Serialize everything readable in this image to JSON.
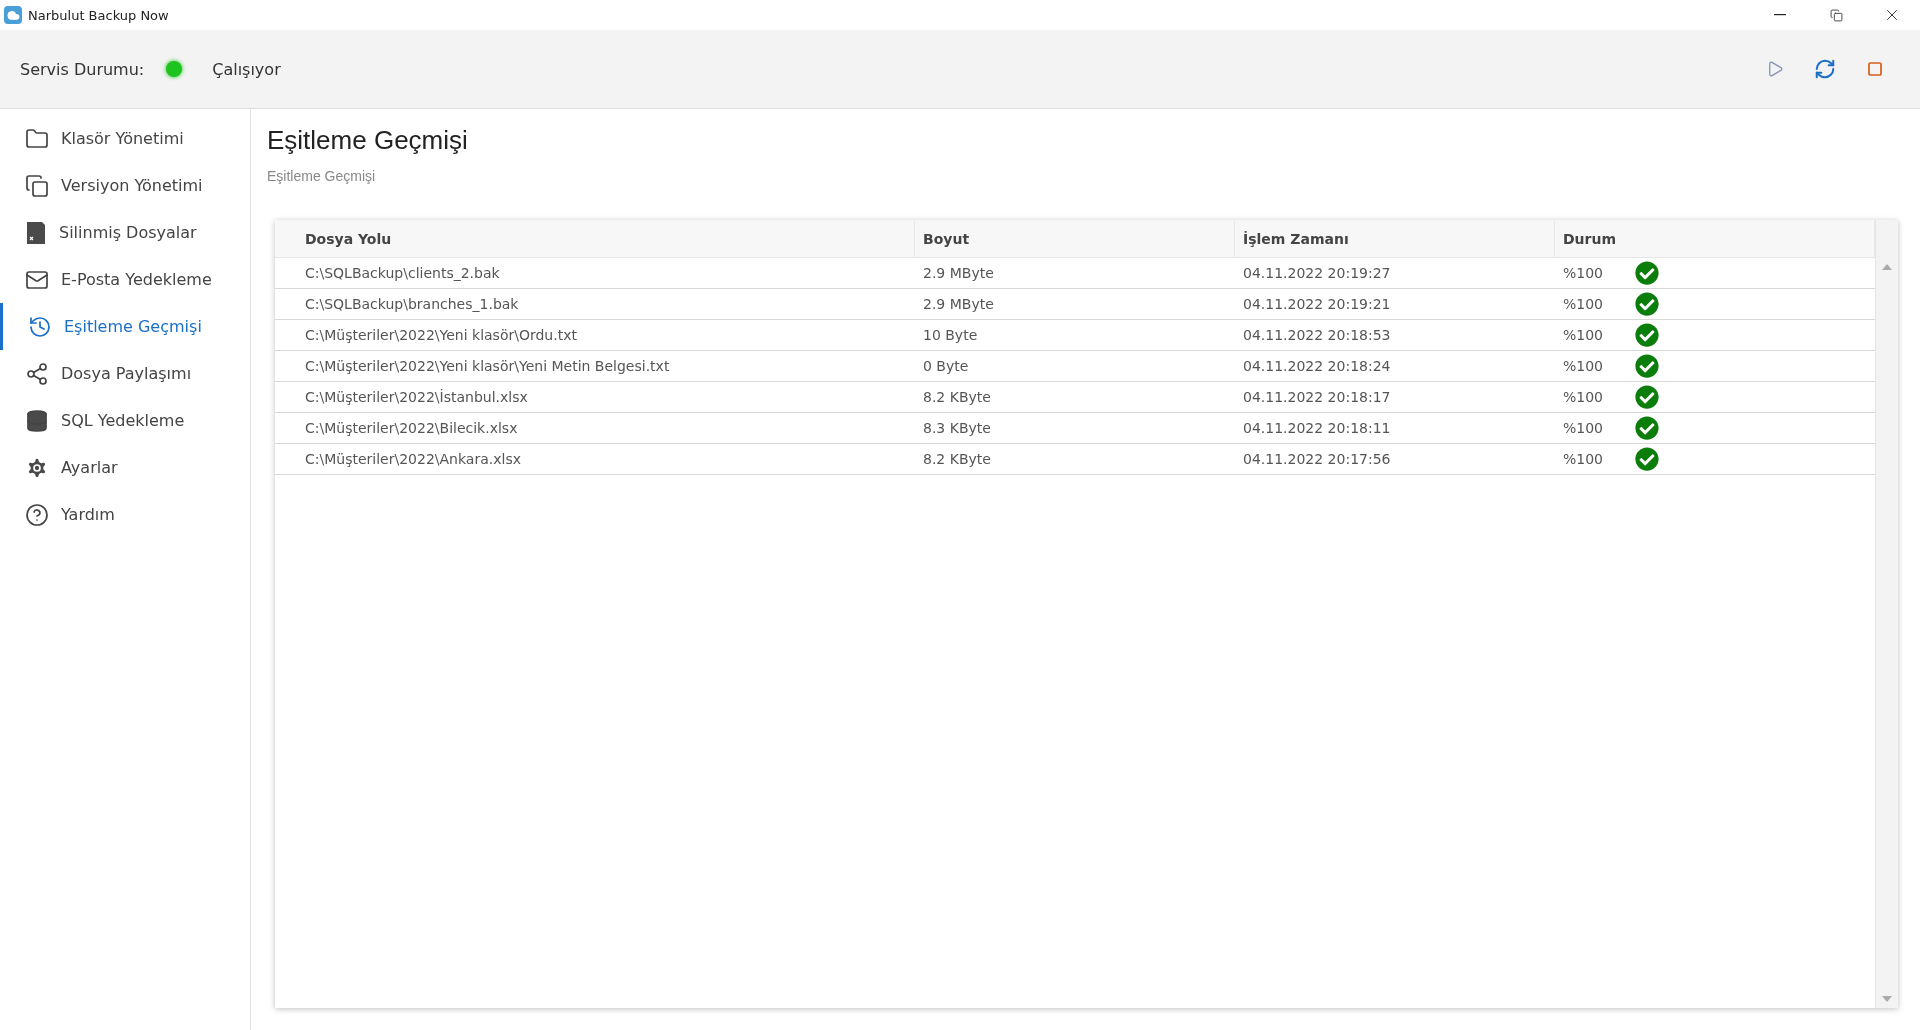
{
  "window": {
    "title": "Narbulut Backup Now"
  },
  "service": {
    "label": "Servis Durumu:",
    "running": true,
    "status_text": "Çalışıyor"
  },
  "sidebar": {
    "items": [
      {
        "label": "Klasör Yönetimi",
        "selected": false
      },
      {
        "label": "Versiyon Yönetimi",
        "selected": false
      },
      {
        "label": "Silinmiş Dosyalar",
        "selected": false
      },
      {
        "label": "E-Posta Yedekleme",
        "selected": false
      },
      {
        "label": "Eşitleme Geçmişi",
        "selected": true
      },
      {
        "label": "Dosya Paylaşımı",
        "selected": false
      },
      {
        "label": "SQL Yedekleme",
        "selected": false
      },
      {
        "label": "Ayarlar",
        "selected": false
      },
      {
        "label": "Yardım",
        "selected": false
      }
    ]
  },
  "page": {
    "title": "Eşitleme Geçmişi",
    "subtitle": "Eşitleme Geçmişi"
  },
  "table": {
    "columns": [
      "Dosya Yolu",
      "Boyut",
      "İşlem Zamanı",
      "Durum"
    ],
    "rows": [
      {
        "path": "C:\\SQLBackup\\clients_2.bak",
        "size": "2.9 MByte",
        "time": "04.11.2022 20:19:27",
        "progress": "%100",
        "done": true
      },
      {
        "path": "C:\\SQLBackup\\branches_1.bak",
        "size": "2.9 MByte",
        "time": "04.11.2022 20:19:21",
        "progress": "%100",
        "done": true
      },
      {
        "path": "C:\\Müşteriler\\2022\\Yeni klasör\\Ordu.txt",
        "size": "10 Byte",
        "time": "04.11.2022 20:18:53",
        "progress": "%100",
        "done": true
      },
      {
        "path": "C:\\Müşteriler\\2022\\Yeni klasör\\Yeni Metin Belgesi.txt",
        "size": "0 Byte",
        "time": "04.11.2022 20:18:24",
        "progress": "%100",
        "done": true
      },
      {
        "path": "C:\\Müşteriler\\2022\\İstanbul.xlsx",
        "size": "8.2 KByte",
        "time": "04.11.2022 20:18:17",
        "progress": "%100",
        "done": true
      },
      {
        "path": "C:\\Müşteriler\\2022\\Bilecik.xlsx",
        "size": "8.3 KByte",
        "time": "04.11.2022 20:18:11",
        "progress": "%100",
        "done": true
      },
      {
        "path": "C:\\Müşteriler\\2022\\Ankara.xlsx",
        "size": "8.2 KByte",
        "time": "04.11.2022 20:17:56",
        "progress": "%100",
        "done": true
      }
    ]
  }
}
